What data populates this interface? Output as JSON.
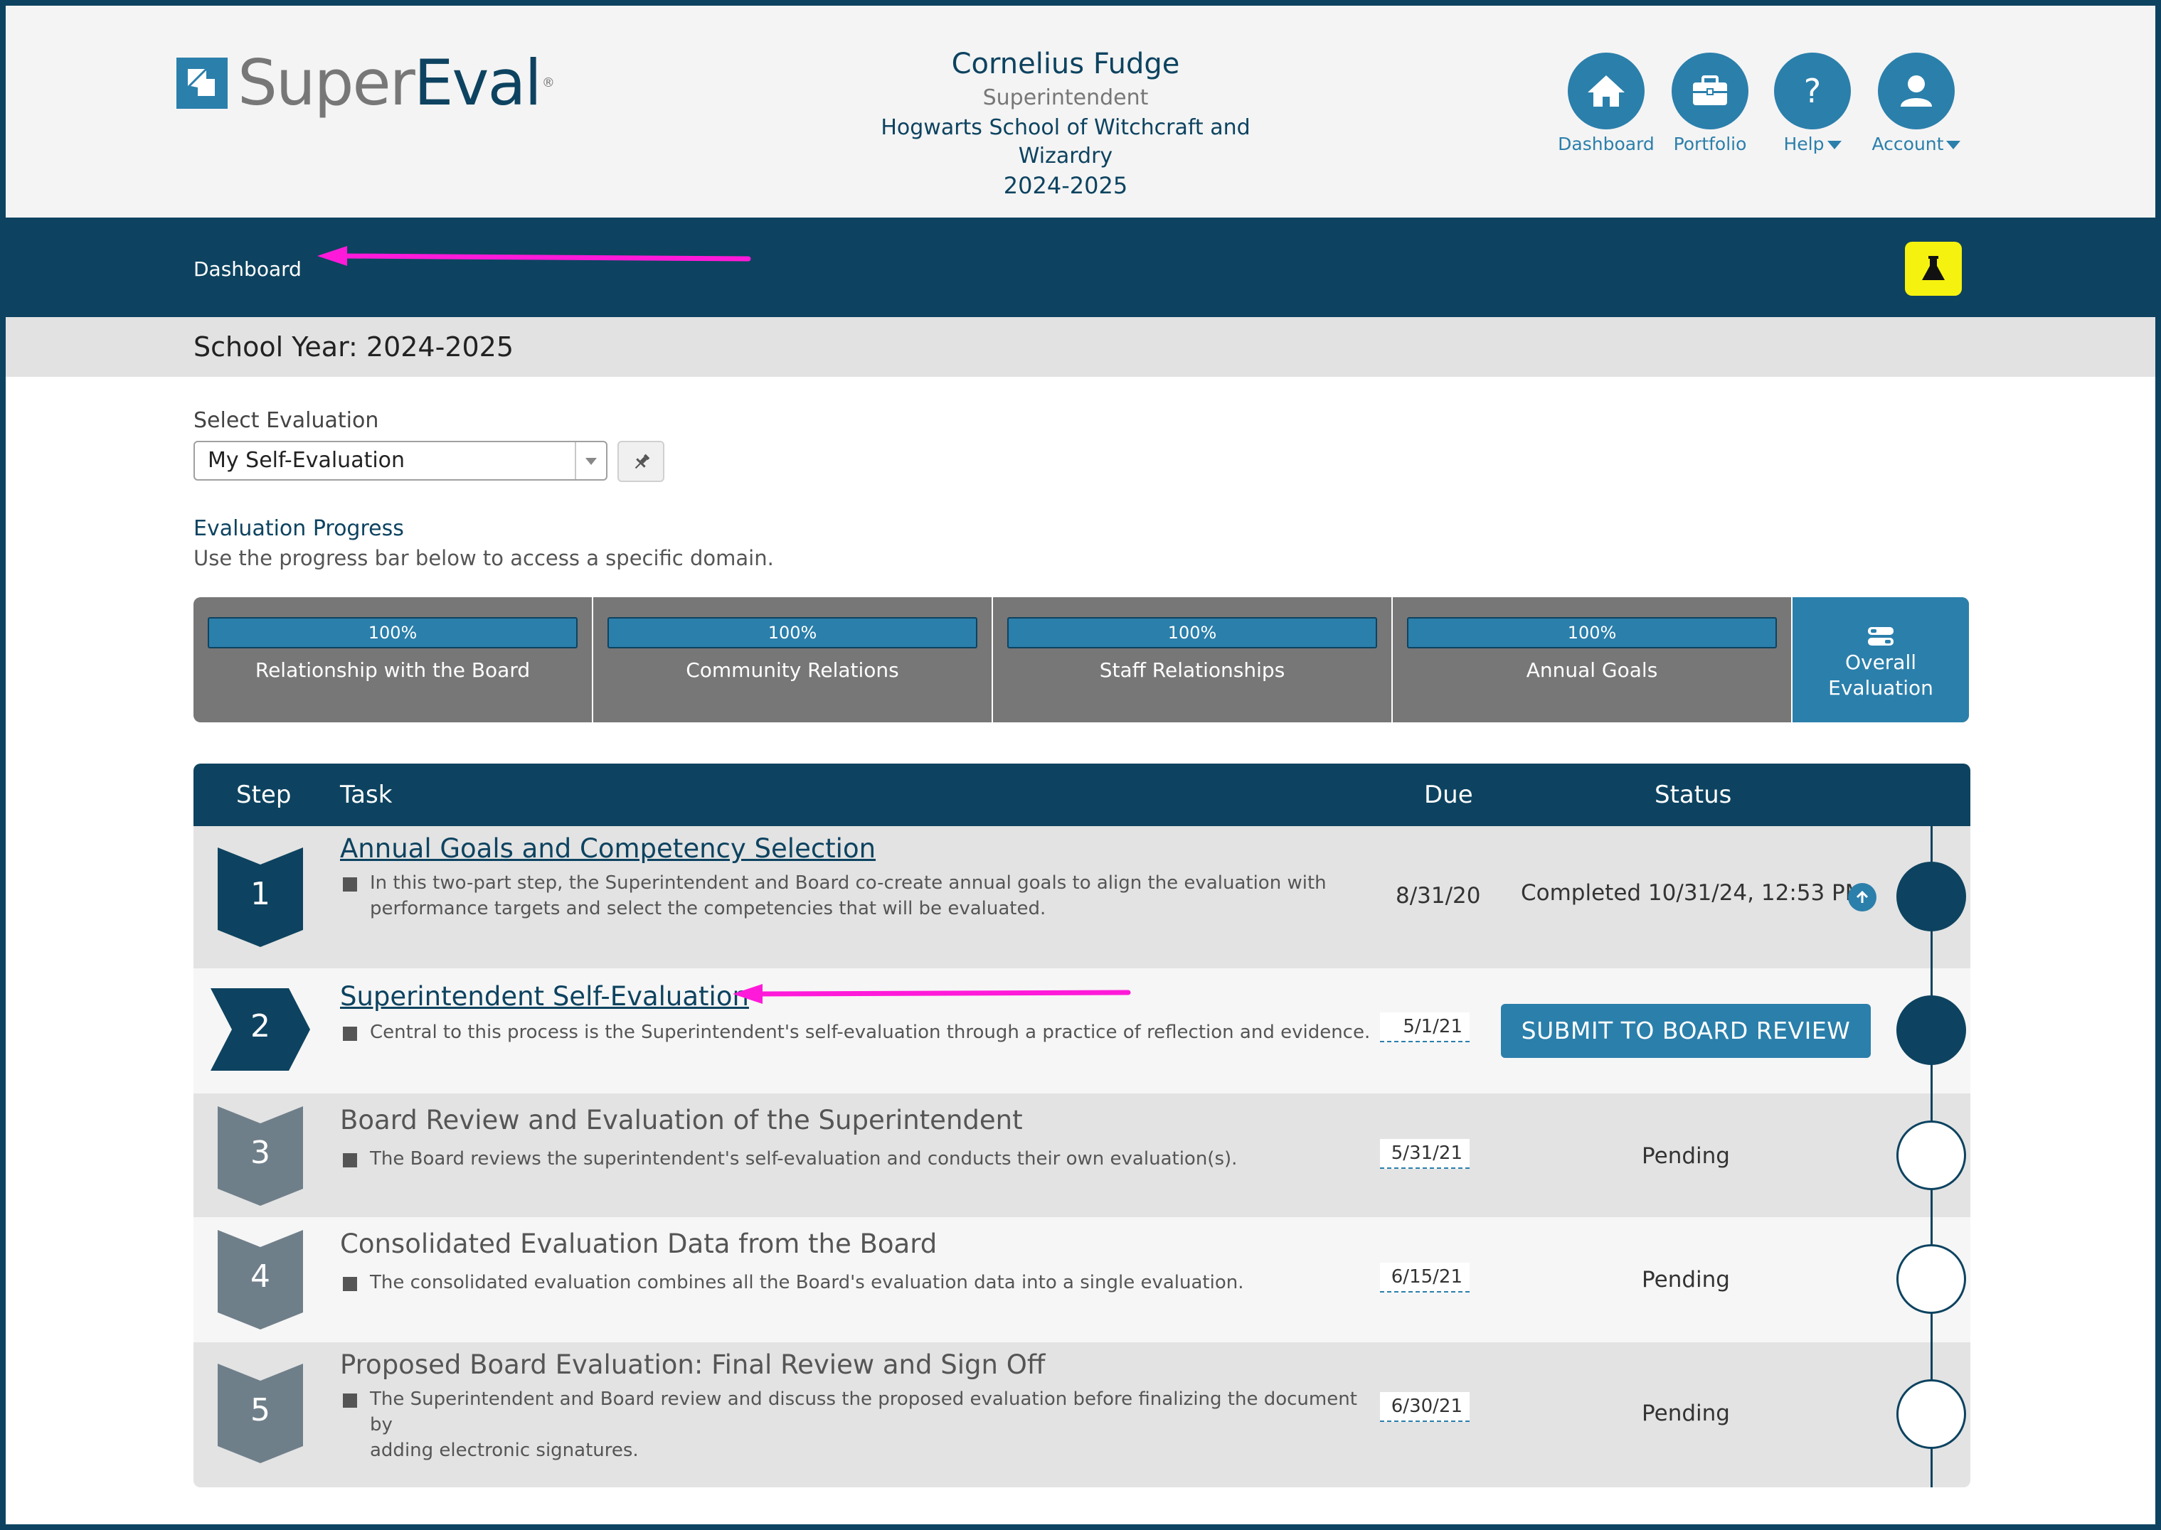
{
  "app": {
    "logo_super": "Super",
    "logo_eval": "Eval",
    "logo_reg": "®"
  },
  "user": {
    "name": "Cornelius Fudge",
    "role": "Superintendent",
    "school_line1": "Hogwarts School of Witchcraft and",
    "school_line2": "Wizardry",
    "year": "2024-2025"
  },
  "nav": {
    "dashboard": "Dashboard",
    "portfolio": "Portfolio",
    "help": "Help",
    "account": "Account"
  },
  "breadcrumb": "Dashboard",
  "school_year_label": "School Year: 2024-2025",
  "select_evaluation": {
    "label": "Select Evaluation",
    "value": "My Self-Evaluation"
  },
  "progress": {
    "title": "Evaluation Progress",
    "subtitle": "Use the progress bar below to access a specific domain.",
    "domains": [
      {
        "label": "Relationship with the Board",
        "percent": "100%"
      },
      {
        "label": "Community Relations",
        "percent": "100%"
      },
      {
        "label": "Staff Relationships",
        "percent": "100%"
      },
      {
        "label": "Annual Goals",
        "percent": "100%"
      }
    ],
    "overall_line1": "Overall",
    "overall_line2": "Evaluation"
  },
  "table": {
    "headers": {
      "step": "Step",
      "task": "Task",
      "due": "Due",
      "status": "Status"
    },
    "rows": [
      {
        "step": "1",
        "title": "Annual Goals and Competency Selection",
        "desc_line1": "In this two-part step, the Superintendent and Board co-create annual goals to align the evaluation with",
        "desc_line2": "performance targets and select the competencies that will be evaluated.",
        "due": "8/31/20",
        "status": "Completed 10/31/24, 12:53 PM"
      },
      {
        "step": "2",
        "title": "Superintendent Self-Evaluation",
        "desc_line1": "Central to this process is the Superintendent's self-evaluation through a practice of reflection and evidence.",
        "due": "5/1/21",
        "status": "SUBMIT TO BOARD REVIEW"
      },
      {
        "step": "3",
        "title": "Board Review and Evaluation of the Superintendent",
        "desc_line1": "The Board reviews the superintendent's self-evaluation and conducts their own evaluation(s).",
        "due": "5/31/21",
        "status": "Pending"
      },
      {
        "step": "4",
        "title": "Consolidated Evaluation Data from the Board",
        "desc_line1": "The consolidated evaluation combines all the Board's evaluation data into a single evaluation.",
        "due": "6/15/21",
        "status": "Pending"
      },
      {
        "step": "5",
        "title": "Proposed Board Evaluation: Final Review and Sign Off",
        "desc_line1": "The Superintendent and Board review and discuss the proposed evaluation before finalizing the document by",
        "desc_line2": "adding electronic signatures.",
        "due": "6/30/21",
        "status": "Pending"
      }
    ]
  },
  "colors": {
    "navy": "#0d4360",
    "blue": "#2b7fab",
    "annotation_arrow": "#ff1ad9",
    "lab_button": "#f6f20f"
  }
}
